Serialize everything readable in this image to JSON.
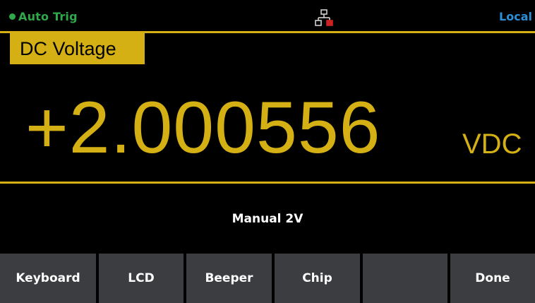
{
  "status": {
    "trigger": "Auto Trig",
    "mode": "Local",
    "colors": {
      "trigger": "#2fa84a",
      "mode": "#2b8ed8",
      "accent": "#d4b014"
    },
    "lan_icon": "network-lan-icon"
  },
  "measurement": {
    "function": "DC Voltage",
    "value": "+2.000556",
    "unit": "VDC",
    "range": "Manual 2V"
  },
  "softkeys": [
    {
      "label": "Keyboard"
    },
    {
      "label": "LCD"
    },
    {
      "label": "Beeper"
    },
    {
      "label": "Chip"
    },
    {
      "label": ""
    },
    {
      "label": "Done"
    }
  ]
}
